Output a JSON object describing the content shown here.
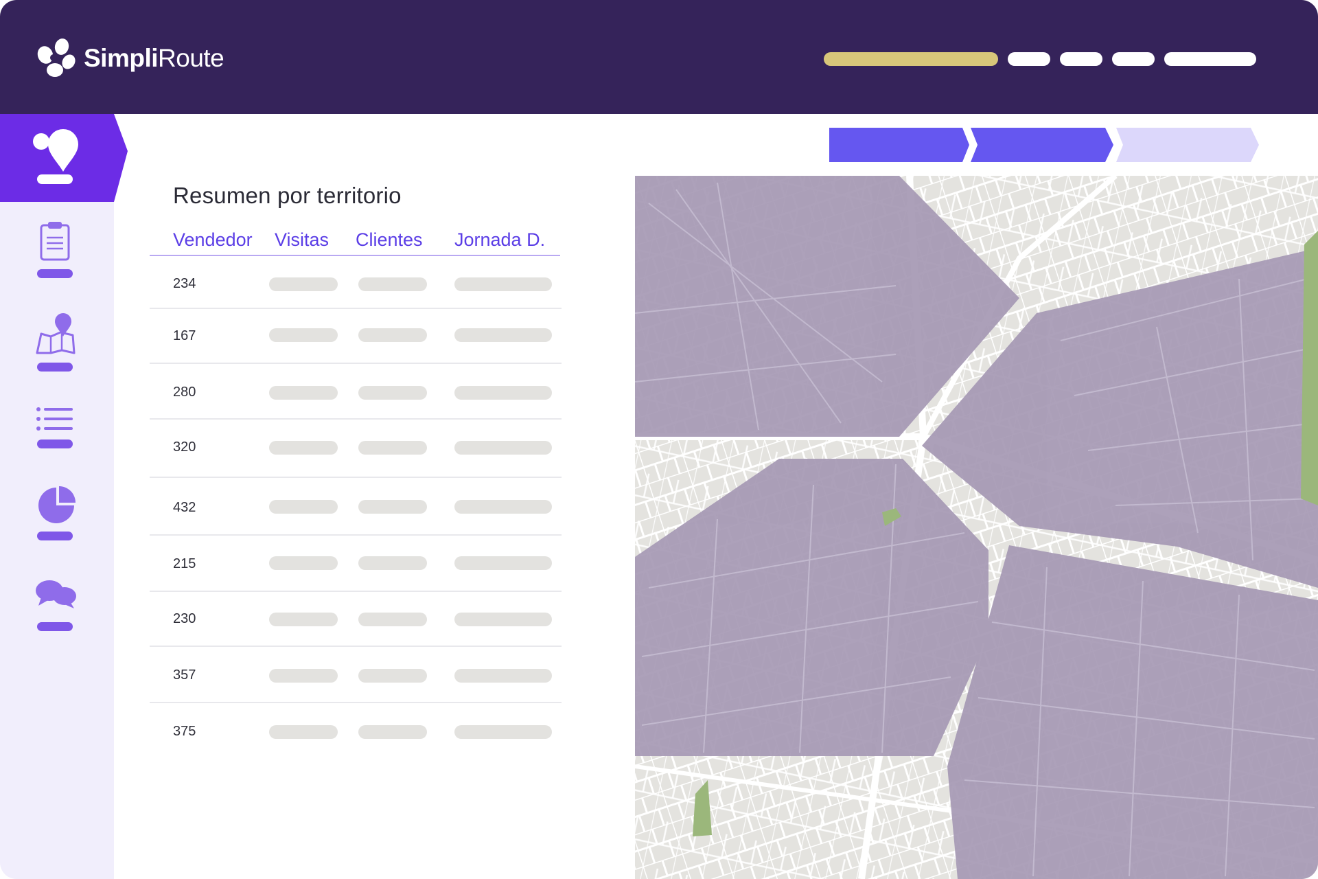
{
  "app": {
    "logo": {
      "brand_bold": "Simpli",
      "brand_light": "Route"
    }
  },
  "sidebar": {
    "items": [
      {
        "icon": "location-pin-icon",
        "active": true
      },
      {
        "icon": "clipboard-icon",
        "active": false
      },
      {
        "icon": "map-pin-icon",
        "active": false
      },
      {
        "icon": "list-icon",
        "active": false
      },
      {
        "icon": "pie-chart-icon",
        "active": false
      },
      {
        "icon": "chat-bubbles-icon",
        "active": false
      }
    ]
  },
  "stepper": {
    "steps": 3,
    "completed": 2
  },
  "panel": {
    "title": "Resumen por territorio",
    "columns": [
      "Vendedor",
      "Visitas",
      "Clientes",
      "Jornada D."
    ],
    "rows": [
      {
        "vendedor": "234"
      },
      {
        "vendedor": "167"
      },
      {
        "vendedor": "280"
      },
      {
        "vendedor": "320"
      },
      {
        "vendedor": "432"
      },
      {
        "vendedor": "215"
      },
      {
        "vendedor": "230"
      },
      {
        "vendedor": "357"
      },
      {
        "vendedor": "375"
      }
    ]
  },
  "colors": {
    "header_bg": "#35235a",
    "accent": "#6c2ce6",
    "step_active": "#6557f0",
    "step_inactive": "#dcd7fb",
    "progress_gold": "#d8c67a",
    "territory": "#a699b4",
    "park_green": "#9bb77b"
  }
}
